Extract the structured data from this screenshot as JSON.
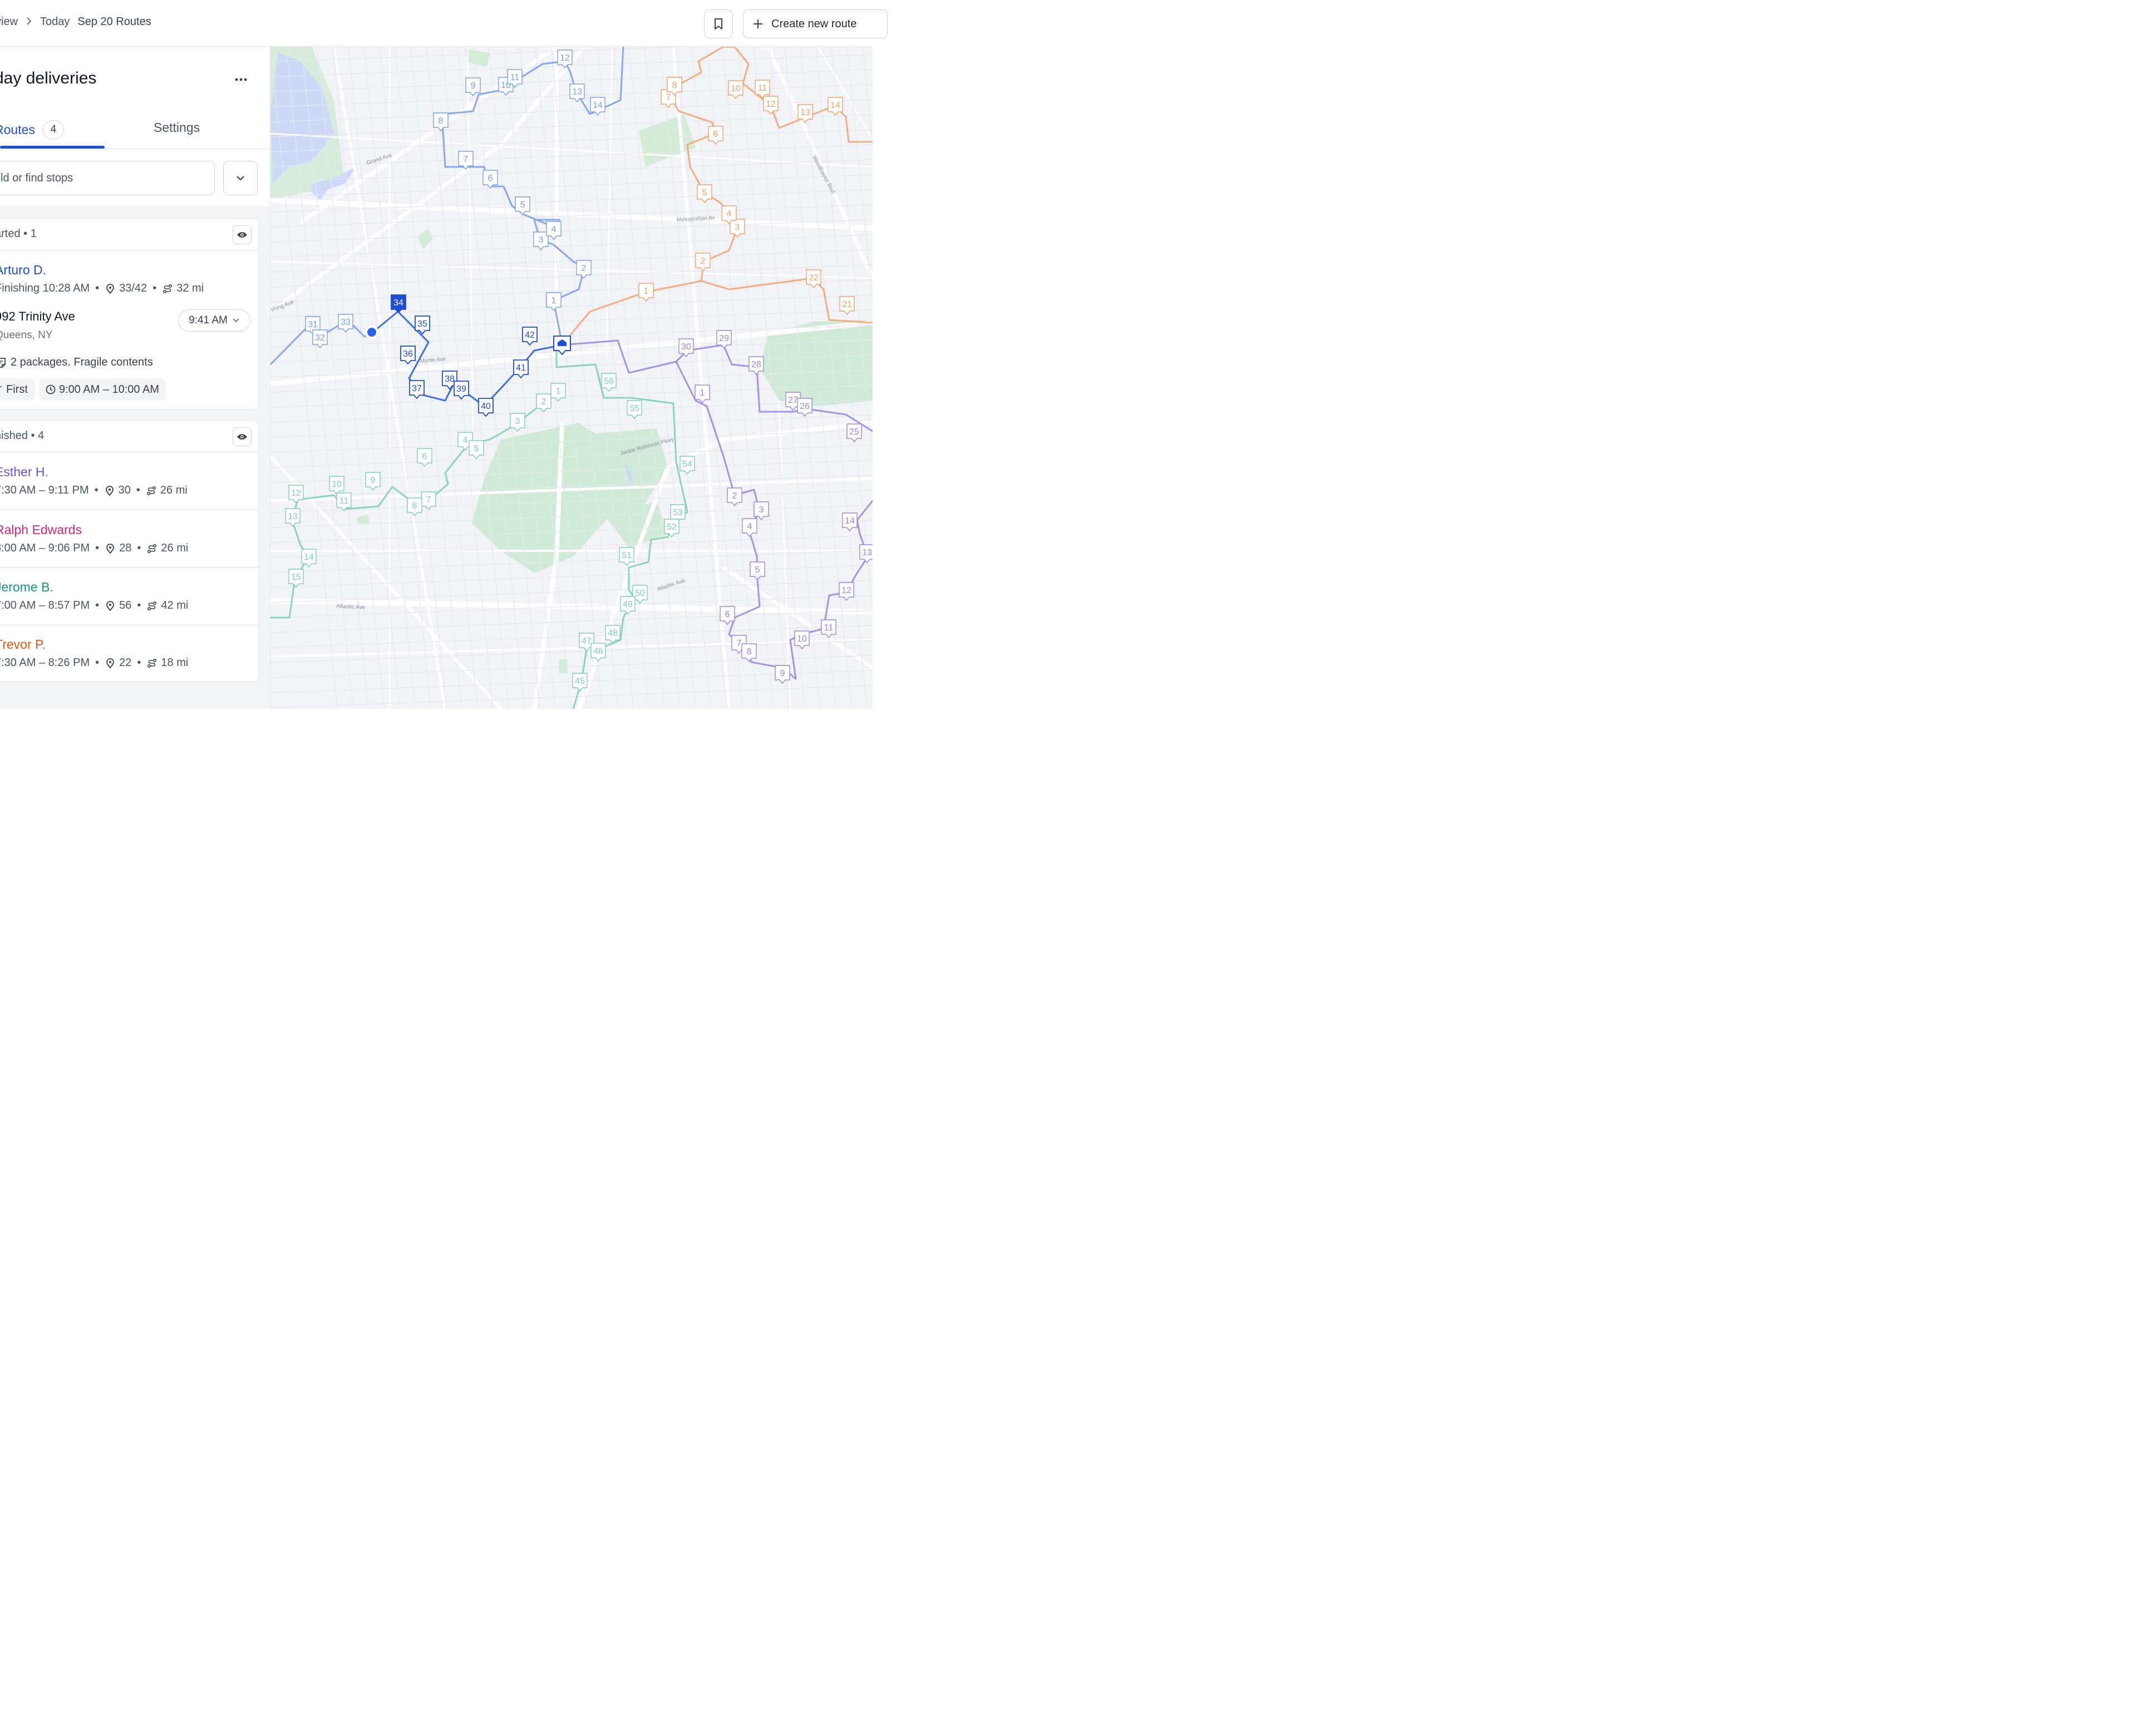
{
  "header": {
    "breadcrumb": [
      "view",
      "Today",
      "Sep 20 Routes"
    ],
    "create_button": "Create new route"
  },
  "panel": {
    "title": "day deliveries",
    "tabs": {
      "routes": "Routes",
      "routes_count": "4",
      "settings": "Settings"
    },
    "search_placeholder": "ld or find stops"
  },
  "started": {
    "label": "arted • 1",
    "driver": {
      "name": "Arturo D.",
      "color": "#1d4ed8",
      "time": "Finishing 10:28 AM",
      "stops": "33/42",
      "distance": "32 mi"
    },
    "stop": {
      "address": "992 Trinity Ave",
      "city": "Queens, NY",
      "eta": "9:41 AM",
      "notes": "2 packages. Fragile contents",
      "priority": "First",
      "window": "9:00 AM – 10:00 AM"
    }
  },
  "finished": {
    "label": "nished • 4",
    "drivers": [
      {
        "name": "Esther H.",
        "color": "#6d4fd8",
        "time": "7:30 AM – 9:11 PM",
        "stops": "30",
        "distance": "26 mi"
      },
      {
        "name": "Ralph Edwards",
        "color": "#db2777",
        "time": "8:00 AM – 9:06 PM",
        "stops": "28",
        "distance": "26 mi"
      },
      {
        "name": "Jerome B.",
        "color": "#0f9a7a",
        "time": "7:00 AM – 8:57 PM",
        "stops": "56",
        "distance": "42 mi"
      },
      {
        "name": "Trevor P.",
        "color": "#ea580c",
        "time": "7:30 AM – 8:26 PM",
        "stops": "22",
        "distance": "18 mi"
      }
    ]
  },
  "map": {
    "street_labels": [
      "Grand Ave",
      "Metropolitan Av",
      "Woodhaven Blvd",
      "Myrtle Ave",
      "Jackie Robinson Pkwy",
      "Atlantic Ave",
      "Atlantic Ave",
      "shing Ave"
    ],
    "routes": {
      "blue": {
        "color": "#7c9ff0",
        "active": "#1d4ed8",
        "stops": [
          "1",
          "2",
          "3",
          "4",
          "5",
          "6",
          "7",
          "8",
          "9",
          "10",
          "11",
          "12",
          "13",
          "14",
          "31",
          "32",
          "33",
          "34",
          "35",
          "36",
          "37",
          "38",
          "39",
          "40",
          "41",
          "42"
        ]
      },
      "orange": {
        "color": "#f5a06b",
        "stops": [
          "1",
          "2",
          "3",
          "4",
          "5",
          "6",
          "7",
          "8",
          "10",
          "11",
          "12",
          "13",
          "14",
          "21",
          "22"
        ]
      },
      "purple": {
        "color": "#9c87e8",
        "stops": [
          "1",
          "2",
          "3",
          "4",
          "5",
          "6",
          "7",
          "8",
          "9",
          "10",
          "11",
          "12",
          "13",
          "14",
          "25",
          "26",
          "27",
          "28",
          "29",
          "30"
        ]
      },
      "teal": {
        "color": "#7fcfb5",
        "stops": [
          "1",
          "2",
          "3",
          "4",
          "5",
          "6",
          "7",
          "8",
          "9",
          "10",
          "11",
          "12",
          "13",
          "14",
          "15",
          "45",
          "46",
          "47",
          "48",
          "49",
          "50",
          "51",
          "52",
          "53",
          "54",
          "55",
          "56"
        ]
      }
    }
  }
}
